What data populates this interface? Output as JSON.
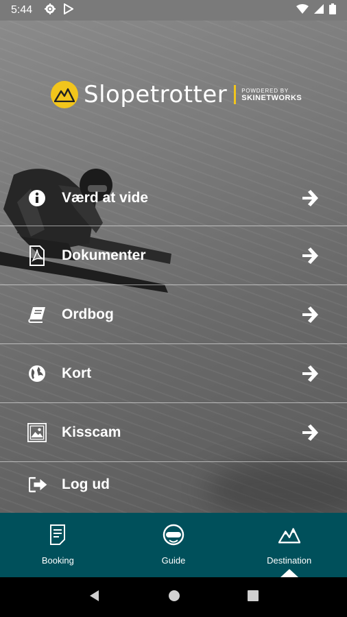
{
  "status_bar": {
    "time": "5:44"
  },
  "logo": {
    "name": "Slopetrotter",
    "powered_by": "POWDERED BY",
    "brand": "SKINETWORKS"
  },
  "menu": {
    "items": [
      {
        "label": "Værd at vide",
        "icon": "info-icon"
      },
      {
        "label": "Dokumenter",
        "icon": "pdf-document-icon"
      },
      {
        "label": "Ordbog",
        "icon": "book-icon"
      },
      {
        "label": "Kort",
        "icon": "globe-icon"
      },
      {
        "label": "Kisscam",
        "icon": "image-icon"
      }
    ],
    "logout": {
      "label": "Log ud",
      "icon": "logout-icon"
    }
  },
  "tabs": [
    {
      "label": "Booking",
      "icon": "document-icon",
      "active": false
    },
    {
      "label": "Guide",
      "icon": "helmet-goggles-icon",
      "active": false
    },
    {
      "label": "Destination",
      "icon": "mountain-icon",
      "active": true
    }
  ],
  "colors": {
    "accent": "#f2c51c",
    "tabbar": "#00505b"
  }
}
